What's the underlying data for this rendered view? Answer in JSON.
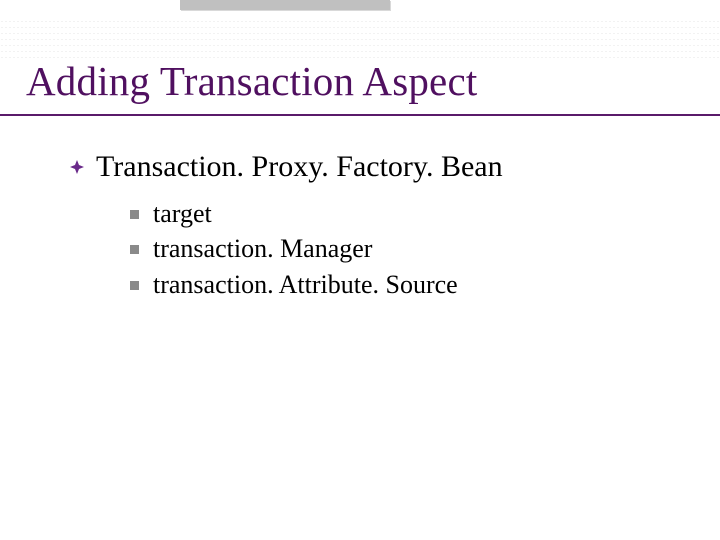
{
  "title": "Adding Transaction Aspect",
  "bullets": {
    "lvl1": [
      {
        "text": "Transaction. Proxy. Factory. Bean"
      }
    ],
    "lvl2": [
      {
        "text": "target"
      },
      {
        "text": "transaction. Manager"
      },
      {
        "text": "transaction. Attribute. Source"
      }
    ]
  },
  "colors": {
    "title": "#501060",
    "underline": "#5a1a6a",
    "lvl2_bullet": "#8a8a8a",
    "topbar": "#c0c0c0"
  }
}
